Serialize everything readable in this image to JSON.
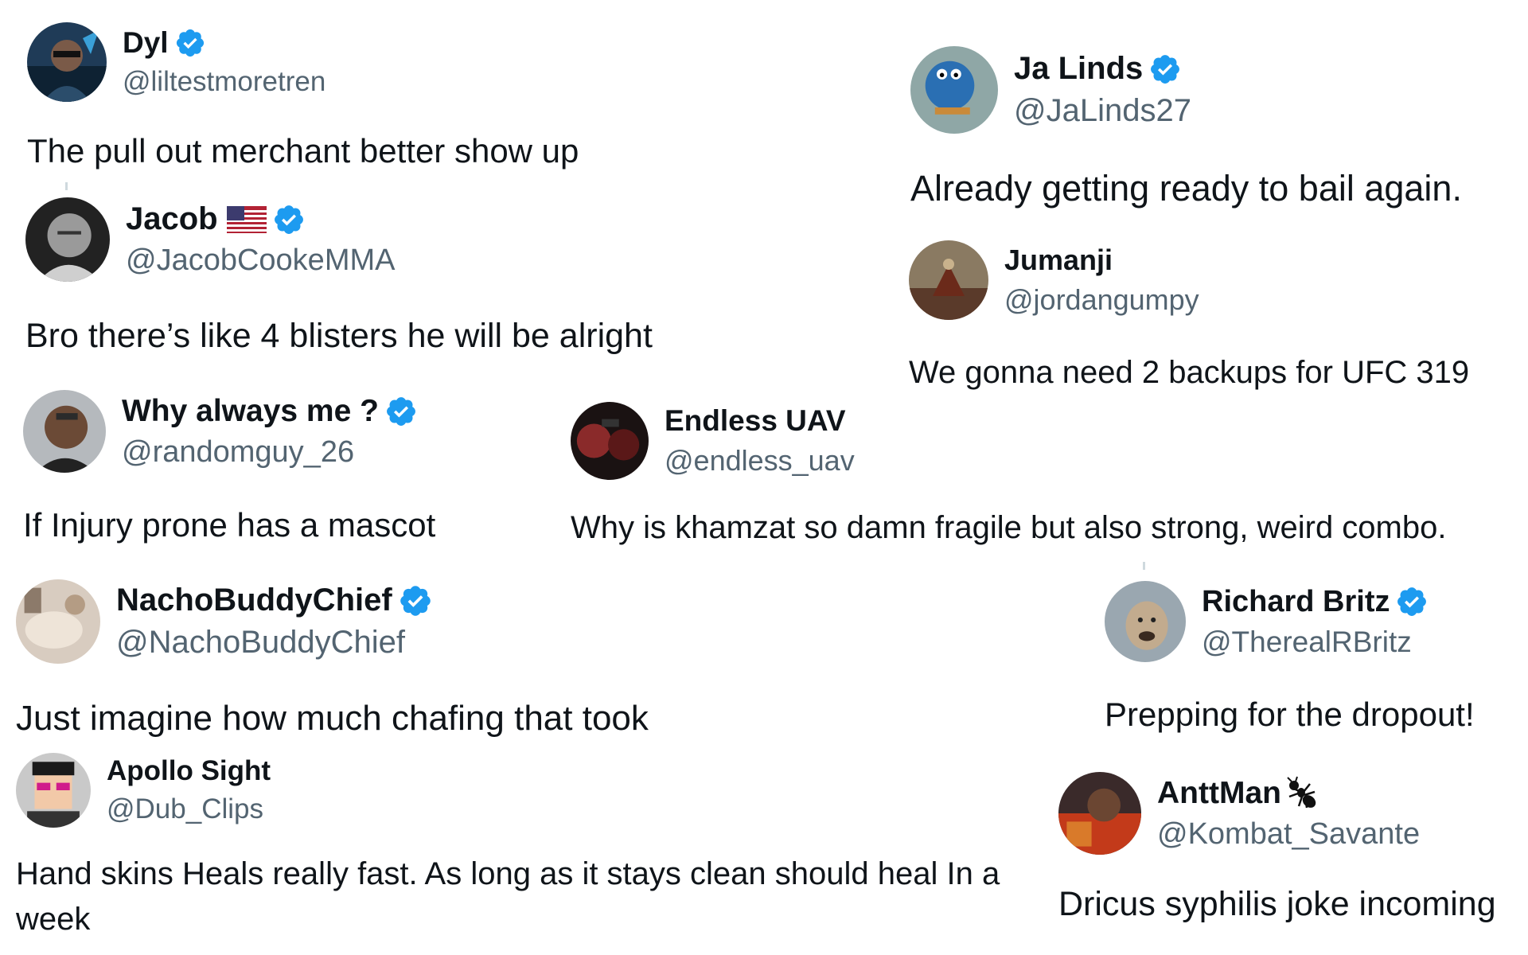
{
  "tweets": {
    "dyl": {
      "name": "Dyl",
      "handle": "@liltestmoretren",
      "text": "The pull out merchant better show up",
      "verified": true
    },
    "jalinds": {
      "name": "Ja Linds",
      "handle": "@JaLinds27",
      "text": "Already getting ready to bail again.",
      "verified": true
    },
    "jacob": {
      "name": "Jacob",
      "handle": "@JacobCookeMMA",
      "text": "Bro there’s like 4 blisters he will be alright",
      "verified": true,
      "flag": "us-flag-icon"
    },
    "jumanji": {
      "name": "Jumanji",
      "handle": "@jordangumpy",
      "text": "We gonna need 2 backups for UFC 319",
      "verified": false
    },
    "whyalwaysme": {
      "name": "Why always me ?",
      "handle": "@randomguy_26",
      "text": "If Injury prone has a mascot",
      "verified": true
    },
    "endlessuav": {
      "name": "Endless UAV",
      "handle": "@endless_uav",
      "text": "Why is khamzat so damn fragile but also strong, weird combo.",
      "verified": false
    },
    "nacho": {
      "name": "NachoBuddyChief",
      "handle": "@NachoBuddyChief",
      "text": "Just imagine how much chafing that took",
      "verified": true
    },
    "richard": {
      "name": "Richard Britz",
      "handle": "@TherealRBritz",
      "text": "Prepping for the dropout!",
      "verified": true
    },
    "apollo": {
      "name": "Apollo Sight",
      "handle": "@Dub_Clips",
      "text": "Hand skins Heals really fast. As long as it stays clean should heal In a week",
      "verified": false
    },
    "anttman": {
      "name": "AnttMan",
      "handle": "@Kombat_Savante",
      "text": "Dricus syphilis joke incoming",
      "verified": false,
      "emoji": "ant-icon"
    }
  },
  "colors": {
    "verified_blue": "#1d9bf0",
    "handle_gray": "#536471",
    "text_black": "#0f1419"
  }
}
